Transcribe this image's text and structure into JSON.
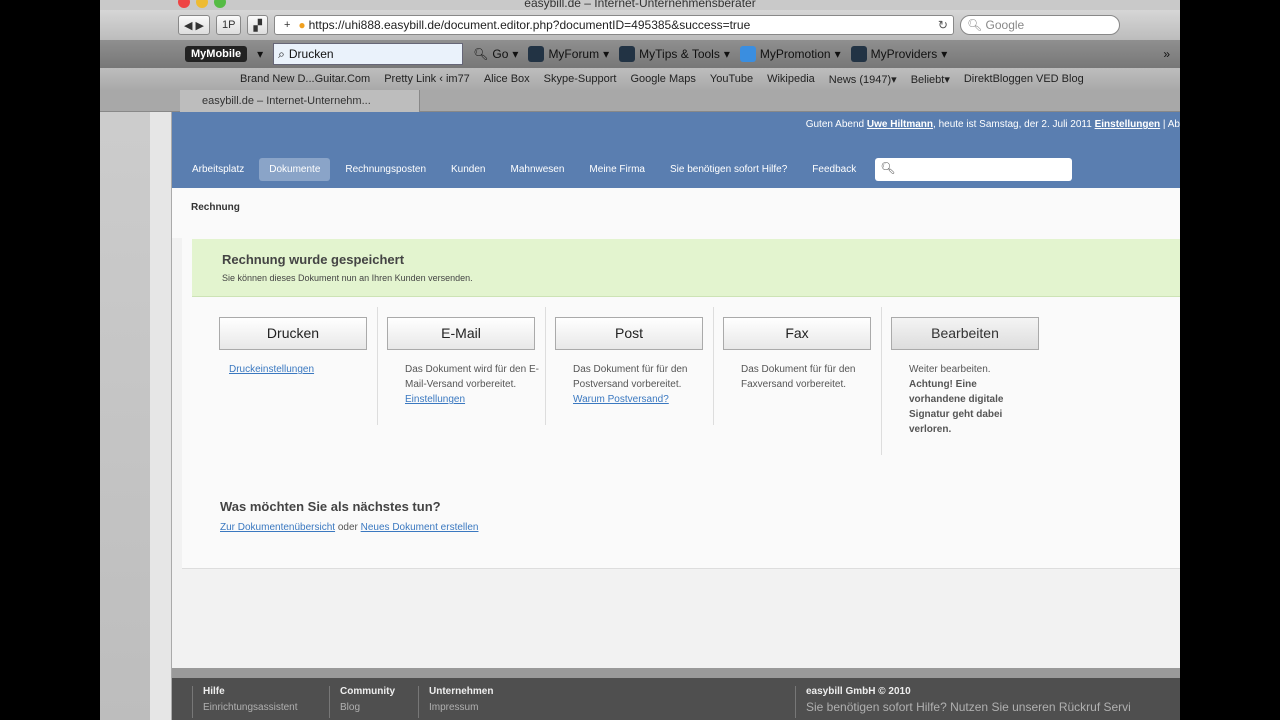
{
  "browser": {
    "title": "easybill.de – Internet-Unternehmensberater",
    "url": "https://uhi888.easybill.de/document.editor.php?documentID=495385&success=true",
    "google_placeholder": "Google",
    "buttons": {
      "back": "◀",
      "forward": "▶",
      "onep": "1P",
      "add": "+"
    }
  },
  "toolbar": {
    "logo": "MyMobile",
    "search_value": "Drucken",
    "go": "Go",
    "items": [
      "MyForum",
      "MyTips & Tools",
      "MyPromotion",
      "MyProviders"
    ],
    "more": "»"
  },
  "bookmarks": [
    "Brand New D...Guitar.Com",
    "Pretty Link ‹ im77",
    "Alice Box",
    "Skype-Support",
    "Google Maps",
    "YouTube",
    "Wikipedia",
    "News (1947)▾",
    "Beliebt▾",
    "DirektBloggen VED Blog"
  ],
  "tab": {
    "label": "easybill.de – Internet-Unternehm..."
  },
  "header": {
    "greet_pre": "Guten Abend ",
    "user": "Uwe Hiltmann",
    "greet_mid": ", heute ist Samstag, der 2. Juli 2011 ",
    "settings": "Einstellungen",
    "sep": " | Ab"
  },
  "nav": [
    "Arbeitsplatz",
    "Dokumente",
    "Rechnungsposten",
    "Kunden",
    "Mahnwesen",
    "Meine Firma",
    "Sie benötigen sofort Hilfe?",
    "Feedback"
  ],
  "breadcrumb": "Rechnung",
  "success": {
    "title": "Rechnung wurde gespeichert",
    "text": "Sie können dieses Dokument nun an Ihren Kunden versenden."
  },
  "actions": [
    {
      "label": "Drucken",
      "link": "Druckeinstellungen"
    },
    {
      "label": "E-Mail",
      "text": "Das Dokument wird für den E-Mail-Versand vorbereitet.",
      "link": "Einstellungen"
    },
    {
      "label": "Post",
      "text": "Das Dokument für für den Postversand vorbereitet.",
      "link": "Warum Postversand?"
    },
    {
      "label": "Fax",
      "text": "Das Dokument für für den Faxversand vorbereitet."
    },
    {
      "label": "Bearbeiten",
      "text": "Weiter bearbeiten.",
      "warning": "Achtung! Eine vorhandene digitale Signatur geht dabei verloren."
    }
  ],
  "next": {
    "title": "Was möchten Sie als nächstes tun?",
    "link1": "Zur Dokumentenübersicht",
    "or": " oder ",
    "link2": "Neues Dokument erstellen"
  },
  "footer": [
    {
      "title": "Hilfe",
      "sub": "Einrichtungsassistent"
    },
    {
      "title": "Community",
      "sub": "Blog"
    },
    {
      "title": "Unternehmen",
      "sub": "Impressum"
    },
    {
      "title": "easybill GmbH © 2010",
      "sub": "Sie benötigen sofort Hilfe? Nutzen Sie unseren Rückruf Servi"
    }
  ]
}
